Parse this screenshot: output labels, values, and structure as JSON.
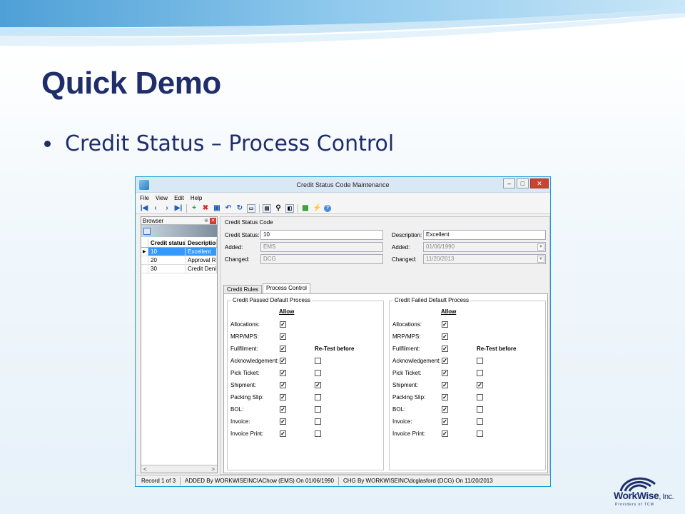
{
  "slide": {
    "title": "Quick Demo",
    "bullet": "Credit Status – Process Control"
  },
  "window": {
    "title": "Credit Status Code Maintenance",
    "controls": [
      "–",
      "□",
      "✕"
    ],
    "menu": [
      "File",
      "View",
      "Edit",
      "Help"
    ]
  },
  "browser": {
    "title": "Browser",
    "columns": [
      "Credit status",
      "Description"
    ],
    "rows": [
      {
        "code": "10",
        "desc": "Excellent"
      },
      {
        "code": "20",
        "desc": "Approval Req"
      },
      {
        "code": "30",
        "desc": "Credit Denied"
      }
    ],
    "scroll_left": "<",
    "scroll_right": ">"
  },
  "header_group": {
    "title": "Credit Status Code",
    "credit_status_label": "Credit Status:",
    "credit_status_value": "10",
    "description_label": "Description:",
    "description_value": "Excellent",
    "added_label": "Added:",
    "added_by": "EMS",
    "added_date": "01/06/1990",
    "changed_label": "Changed:",
    "changed_by": "DCG",
    "changed_date": "11/20/2013"
  },
  "tabs": [
    "Credit Rules",
    "Process Control"
  ],
  "passed": {
    "title": "Credit Passed Default Process",
    "allow": "Allow",
    "retest": "Re-Test before",
    "rows": [
      {
        "label": "Allocations:",
        "allow": true,
        "retest": null
      },
      {
        "label": "MRP/MPS:",
        "allow": true,
        "retest": null
      },
      {
        "label": "Fullfilment:",
        "allow": true,
        "retest": null
      },
      {
        "label": "Acknowledgement:",
        "allow": true,
        "retest": false
      },
      {
        "label": "Pick Ticket:",
        "allow": true,
        "retest": false
      },
      {
        "label": "Shipment:",
        "allow": true,
        "retest": true
      },
      {
        "label": "Packing Slip:",
        "allow": true,
        "retest": false
      },
      {
        "label": "BOL:",
        "allow": true,
        "retest": false
      },
      {
        "label": "Invoice:",
        "allow": true,
        "retest": false
      },
      {
        "label": "Invoice Print:",
        "allow": true,
        "retest": false
      }
    ]
  },
  "failed": {
    "title": "Credit Failed Default Process",
    "allow": "Allow",
    "retest": "Re-Test before",
    "rows": [
      {
        "label": "Allocations:",
        "allow": true,
        "retest": null
      },
      {
        "label": "MRP/MPS:",
        "allow": true,
        "retest": null
      },
      {
        "label": "Fullfilment:",
        "allow": true,
        "retest": null
      },
      {
        "label": "Acknowledgement:",
        "allow": true,
        "retest": false
      },
      {
        "label": "Pick Ticket:",
        "allow": true,
        "retest": false
      },
      {
        "label": "Shipment:",
        "allow": true,
        "retest": true
      },
      {
        "label": "Packing Slip:",
        "allow": true,
        "retest": false
      },
      {
        "label": "BOL:",
        "allow": true,
        "retest": false
      },
      {
        "label": "Invoice:",
        "allow": true,
        "retest": false
      },
      {
        "label": "Invoice Print:",
        "allow": true,
        "retest": false
      }
    ]
  },
  "status": {
    "record": "Record 1 of 3",
    "added": "ADDED By WORKWISEINC\\AChow (EMS) On 01/06/1990",
    "changed": "CHG By WORKWISEINC\\dcglasford (DCG)   On 11/20/2013"
  },
  "logo": {
    "brand": "WorkWise",
    "suffix": ", Inc.",
    "tagline": "Providers of TCM"
  },
  "colors": {
    "title": "#1f2d6b",
    "window_border": "#1b9cd9",
    "selection": "#3399ff"
  }
}
